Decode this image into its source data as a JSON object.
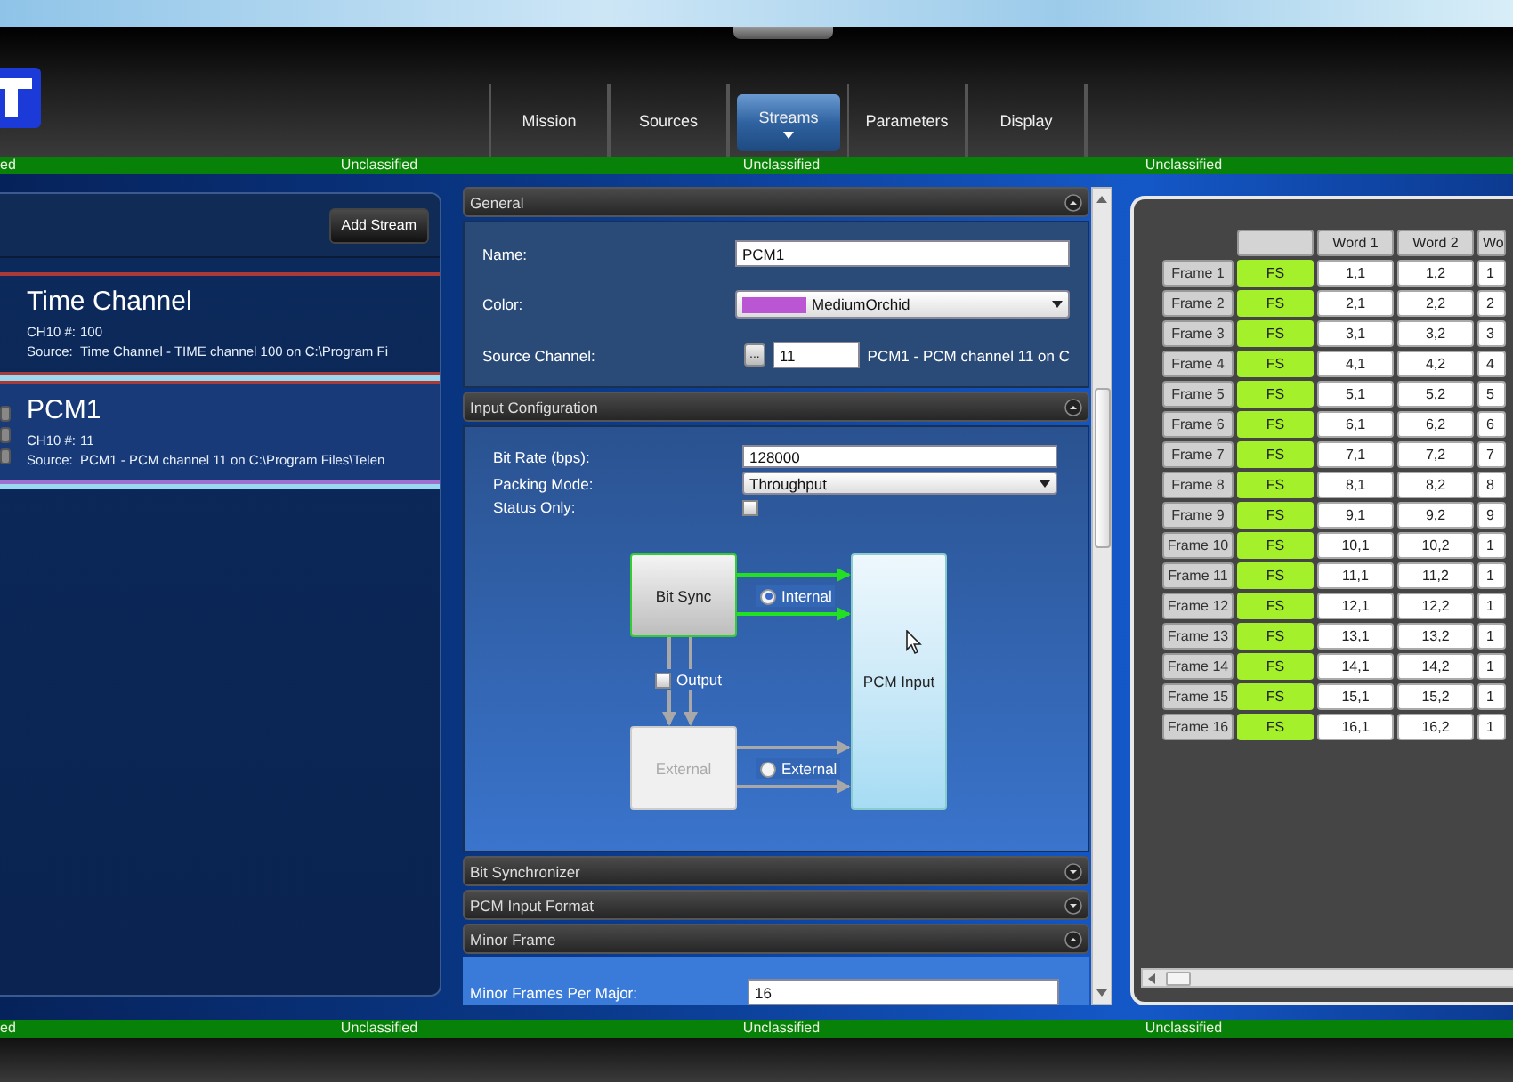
{
  "tabs": [
    {
      "label": "Mission",
      "selected": false
    },
    {
      "label": "Sources",
      "selected": false
    },
    {
      "label": "Streams",
      "selected": true
    },
    {
      "label": "Parameters",
      "selected": false
    },
    {
      "label": "Display",
      "selected": false
    }
  ],
  "banner_top": [
    "ed",
    "Unclassified",
    "Unclassified",
    "Unclassified"
  ],
  "banner_bottom": [
    "ed",
    "Unclassified",
    "Unclassified",
    "Unclassified"
  ],
  "streams_panel": {
    "add_button": "Add Stream",
    "streams": [
      {
        "title": "Time Channel",
        "ch10_label": "CH10 #:",
        "ch10": "100",
        "source_label": "Source:",
        "source": "Time Channel - TIME channel 100 on C:\\Program Fi",
        "selected": false
      },
      {
        "title": "PCM1",
        "ch10_label": "CH10 #:",
        "ch10": "11",
        "source_label": "Source:",
        "source": "PCM1 - PCM channel 11 on C:\\Program Files\\Telen",
        "selected": true
      }
    ]
  },
  "sections": [
    {
      "kind": "general",
      "title": "General",
      "expanded": true,
      "name_label": "Name:",
      "name": "PCM1",
      "color_label": "Color:",
      "color": "#ba55d3",
      "color_name": "MediumOrchid",
      "source_label": "Source Channel:",
      "browse": "...",
      "source_channel": "11",
      "source_text": "PCM1 - PCM channel 11 on C"
    },
    {
      "kind": "input",
      "title": "Input Configuration",
      "expanded": true,
      "bit_rate_label": "Bit Rate (bps):",
      "bit_rate": "128000",
      "packing_label": "Packing Mode:",
      "packing": "Throughput",
      "status_label": "Status Only:",
      "status_only": false,
      "diagram": {
        "bit_sync": "Bit Sync",
        "internal": {
          "label": "Internal",
          "selected": true
        },
        "output": {
          "label": "Output",
          "checked": false
        },
        "external_box": "External",
        "external": {
          "label": "External",
          "selected": false
        },
        "pcm_input": "PCM Input"
      }
    },
    {
      "title": "Bit Synchronizer",
      "expanded": false
    },
    {
      "title": "PCM Input Format",
      "expanded": false
    },
    {
      "kind": "minor_frame",
      "title": "Minor Frame",
      "expanded": true,
      "frames_label": "Minor Frames Per Major:",
      "frames": "16"
    }
  ],
  "grid": {
    "columns": [
      "",
      "",
      "Word 1",
      "Word 2",
      "Wo"
    ],
    "rows": [
      {
        "cells": [
          "Frame 1",
          "FS",
          "1,1",
          "1,2",
          "1"
        ]
      },
      {
        "cells": [
          "Frame 2",
          "FS",
          "2,1",
          "2,2",
          "2"
        ]
      },
      {
        "cells": [
          "Frame 3",
          "FS",
          "3,1",
          "3,2",
          "3"
        ]
      },
      {
        "cells": [
          "Frame 4",
          "FS",
          "4,1",
          "4,2",
          "4"
        ]
      },
      {
        "cells": [
          "Frame 5",
          "FS",
          "5,1",
          "5,2",
          "5"
        ]
      },
      {
        "cells": [
          "Frame 6",
          "FS",
          "6,1",
          "6,2",
          "6"
        ]
      },
      {
        "cells": [
          "Frame 7",
          "FS",
          "7,1",
          "7,2",
          "7"
        ]
      },
      {
        "cells": [
          "Frame 8",
          "FS",
          "8,1",
          "8,2",
          "8"
        ]
      },
      {
        "cells": [
          "Frame 9",
          "FS",
          "9,1",
          "9,2",
          "9"
        ]
      },
      {
        "cells": [
          "Frame 10",
          "FS",
          "10,1",
          "10,2",
          "1"
        ]
      },
      {
        "cells": [
          "Frame 11",
          "FS",
          "11,1",
          "11,2",
          "1"
        ]
      },
      {
        "cells": [
          "Frame 12",
          "FS",
          "12,1",
          "12,2",
          "1"
        ]
      },
      {
        "cells": [
          "Frame 13",
          "FS",
          "13,1",
          "13,2",
          "1"
        ]
      },
      {
        "cells": [
          "Frame 14",
          "FS",
          "14,1",
          "14,2",
          "1"
        ]
      },
      {
        "cells": [
          "Frame 15",
          "FS",
          "15,1",
          "15,2",
          "1"
        ]
      },
      {
        "cells": [
          "Frame 16",
          "FS",
          "16,1",
          "16,2",
          "1"
        ]
      }
    ]
  }
}
